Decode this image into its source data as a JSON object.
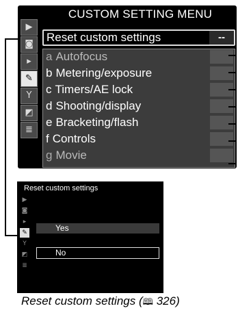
{
  "menu": {
    "title": "CUSTOM SETTING MENU",
    "reset_label": "Reset custom settings",
    "reset_value": "--",
    "items": [
      {
        "letter": "a",
        "label": "Autofocus"
      },
      {
        "letter": "b",
        "label": "Metering/exposure"
      },
      {
        "letter": "c",
        "label": "Timers/AE lock"
      },
      {
        "letter": "d",
        "label": "Shooting/display"
      },
      {
        "letter": "e",
        "label": "Bracketing/flash"
      },
      {
        "letter": "f",
        "label": "Controls"
      },
      {
        "letter": "g",
        "label": "Movie"
      }
    ],
    "side_icons": [
      "playback-icon",
      "camera-icon",
      "movie-icon",
      "pencil-icon",
      "wrench-icon",
      "retouch-icon",
      "my-menu-icon"
    ]
  },
  "submenu": {
    "title": "Reset custom settings",
    "options": [
      "Yes",
      "No"
    ],
    "selected": "No"
  },
  "caption": {
    "text": "Reset custom settings (",
    "page_ref": "326",
    "close": ")"
  }
}
